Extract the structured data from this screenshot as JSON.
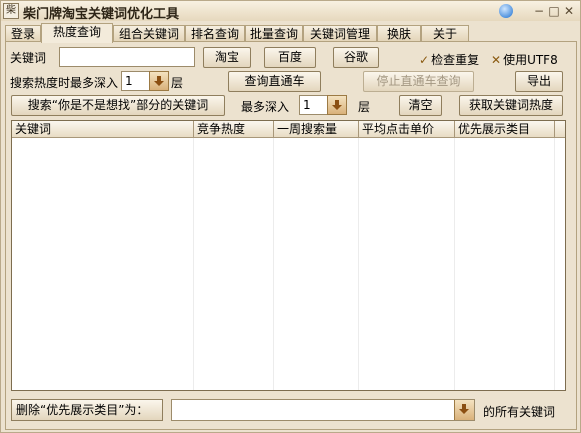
{
  "window": {
    "title": "柴门牌淘宝关键词优化工具",
    "icon_text": "柴",
    "controls": {
      "minimize": "−",
      "maximize": "□",
      "close": "✕"
    }
  },
  "tabs": [
    {
      "label": "登录"
    },
    {
      "label": "热度查询",
      "active": true
    },
    {
      "label": "组合关键词"
    },
    {
      "label": "排名查询"
    },
    {
      "label": "批量查询"
    },
    {
      "label": "关键词管理"
    },
    {
      "label": "换肤"
    },
    {
      "label": "关于"
    }
  ],
  "query": {
    "keyword_label": "关键词",
    "keyword_value": "",
    "taobao_button": "淘宝",
    "baidu_button": "百度",
    "google_button": "谷歌",
    "check_duplicates": "检查重复",
    "use_utf8": "使用UTF8",
    "depth_label": "搜索热度时最多深入",
    "depth_value": "1",
    "depth_unit": "层",
    "ztc_button": "查询直通车",
    "stop_ztc_button": "停止直通车查询",
    "export_button": "导出",
    "search_suggest_button": "搜索“你是不是想找”部分的关键词",
    "max_depth_label": "最多深入",
    "max_depth_value": "1",
    "max_depth_unit": "层",
    "clear_button": "清空",
    "fetch_heat_button": "获取关键词热度"
  },
  "table": {
    "columns": [
      "关键词",
      "竞争热度",
      "一周搜索量",
      "平均点击单价",
      "优先展示类目"
    ],
    "rows": []
  },
  "bottom": {
    "delete_label": "删除“优先展示类目”为：",
    "category_value": "",
    "suffix": "的所有关键词"
  }
}
